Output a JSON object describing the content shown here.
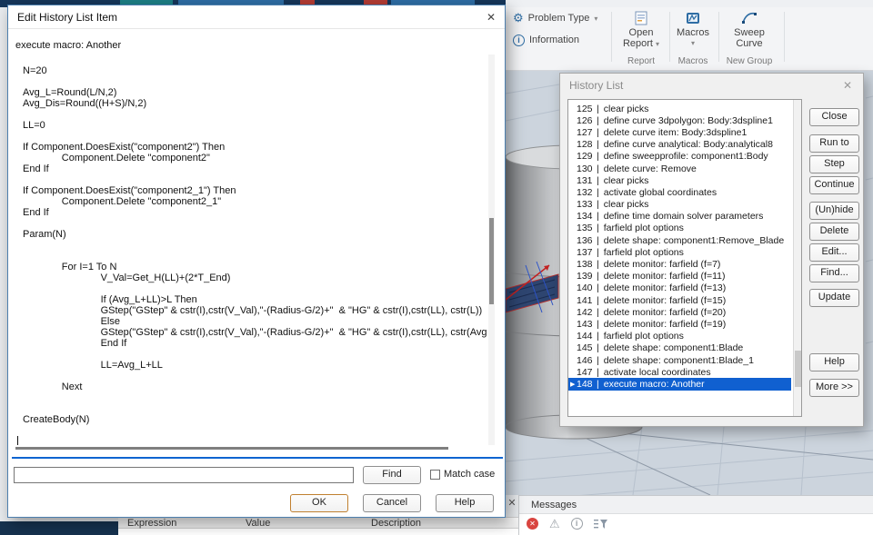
{
  "glyphs": {
    "close": "✕",
    "chevron_down": "▾",
    "selected_marker": "▶",
    "warning": "⚠",
    "gear": "⚙",
    "info_letter": "i",
    "error_x": "✕",
    "list_separator": "|"
  },
  "ribbon": {
    "problem_type_label": "Problem Type",
    "information_label": "Information",
    "open_report_line1": "Open",
    "open_report_line2": "Report",
    "macros_label": "Macros",
    "sweep_line1": "Sweep",
    "sweep_line2": "Curve",
    "group_labels": {
      "report": "Report",
      "macros": "Macros",
      "new_group": "New Group"
    }
  },
  "edit_dialog": {
    "title": "Edit History List Item",
    "subtitle": "execute macro: Another",
    "code_lines": [
      "N=20",
      "",
      "Avg_L=Round(L/N,2)",
      "Avg_Dis=Round((H+S)/N,2)",
      "",
      "LL=0",
      "",
      "If Component.DoesExist(\"component2\") Then",
      "\tComponent.Delete \"component2\"",
      "End If",
      "",
      "If Component.DoesExist(\"component2_1\") Then",
      "\tComponent.Delete \"component2_1\"",
      "End If",
      "",
      "Param(N)",
      "",
      "",
      "\tFor I=1 To N",
      "\t\tV_Val=Get_H(LL)+(2*T_End)",
      "",
      "\t\tIf (Avg_L+LL)>L Then",
      "\t\tGStep(\"GStep\" & cstr(I),cstr(V_Val),\"-(Radius-G/2)+\"  & \"HG\" & cstr(I),cstr(LL), cstr(L))",
      "\t\tElse",
      "\t\tGStep(\"GStep\" & cstr(I),cstr(V_Val),\"-(Radius-G/2)+\"  & \"HG\" & cstr(I),cstr(LL), cstr(Avg_L+LL",
      "\t\tEnd If",
      "",
      "\t\tLL=Avg_L+LL",
      "",
      "\tNext",
      "",
      "",
      "CreateBody(N)"
    ],
    "find": {
      "input_value": "",
      "find_button": "Find",
      "match_case_label": "Match case"
    },
    "buttons": {
      "ok": "OK",
      "cancel": "Cancel",
      "help": "Help"
    }
  },
  "history_dialog": {
    "title": "History List",
    "items": [
      {
        "num": "125",
        "text": "clear picks"
      },
      {
        "num": "126",
        "text": "define curve 3dpolygon: Body:3dspline1"
      },
      {
        "num": "127",
        "text": "delete curve item: Body:3dspline1"
      },
      {
        "num": "128",
        "text": "define curve analytical: Body:analytical8"
      },
      {
        "num": "129",
        "text": "define sweepprofile: component1:Body"
      },
      {
        "num": "130",
        "text": "delete curve: Remove"
      },
      {
        "num": "131",
        "text": "clear picks"
      },
      {
        "num": "132",
        "text": "activate global coordinates"
      },
      {
        "num": "133",
        "text": "clear picks"
      },
      {
        "num": "134",
        "text": "define time domain solver parameters"
      },
      {
        "num": "135",
        "text": "farfield plot options"
      },
      {
        "num": "136",
        "text": "delete shape: component1:Remove_Blade"
      },
      {
        "num": "137",
        "text": "farfield plot options"
      },
      {
        "num": "138",
        "text": "delete monitor: farfield (f=7)"
      },
      {
        "num": "139",
        "text": "delete monitor: farfield (f=11)"
      },
      {
        "num": "140",
        "text": "delete monitor: farfield (f=13)"
      },
      {
        "num": "141",
        "text": "delete monitor: farfield (f=15)"
      },
      {
        "num": "142",
        "text": "delete monitor: farfield (f=20)"
      },
      {
        "num": "143",
        "text": "delete monitor: farfield (f=19)"
      },
      {
        "num": "144",
        "text": "farfield plot options"
      },
      {
        "num": "145",
        "text": "delete shape: component1:Blade"
      },
      {
        "num": "146",
        "text": "delete shape: component1:Blade_1"
      },
      {
        "num": "147",
        "text": "activate local coordinates"
      },
      {
        "num": "148",
        "text": "execute macro: Another",
        "selected": true
      }
    ],
    "buttons": [
      {
        "label": "Close"
      },
      {
        "label": "Run to"
      },
      {
        "label": "Step"
      },
      {
        "label": "Continue"
      },
      {
        "label": "(Un)hide"
      },
      {
        "label": "Delete"
      },
      {
        "label": "Edit..."
      },
      {
        "label": "Find..."
      },
      {
        "label": "Update"
      },
      {
        "label": "Help"
      },
      {
        "label": "More >>"
      }
    ]
  },
  "messages_panel": {
    "title": "Messages"
  },
  "param_table": {
    "headers": [
      "Expression",
      "Value",
      "Description"
    ]
  },
  "colors": {
    "selection": "#1060d0",
    "separator_blue": "#0a64d0",
    "viewport_bg": "#ccd4dd"
  }
}
